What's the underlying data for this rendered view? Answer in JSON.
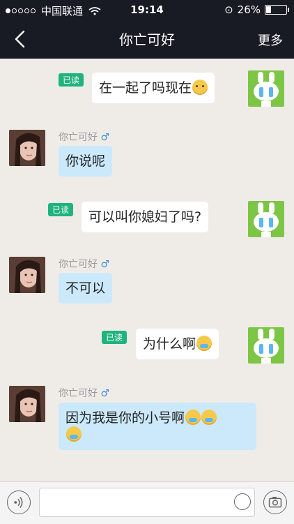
{
  "status": {
    "carrier": "中国联通",
    "time": "19:14",
    "battery": "26%",
    "battery_level": 0.26
  },
  "nav": {
    "title": "你亡可好",
    "more_label": "更多"
  },
  "contact": {
    "name": "你亡可好",
    "gender_icon": "♂"
  },
  "read_label": "已读",
  "messages": [
    {
      "from": "me",
      "text": "在一起了吗现在",
      "emoji": "shy"
    },
    {
      "from": "them",
      "text": "你说呢"
    },
    {
      "from": "me",
      "text": "可以叫你媳妇了吗?"
    },
    {
      "from": "them",
      "text": "不可以"
    },
    {
      "from": "me",
      "text": "为什么啊",
      "emoji": "cry"
    },
    {
      "from": "them",
      "text": "因为我是你的小号啊",
      "emoji": "cry"
    }
  ],
  "input": {
    "placeholder": ""
  },
  "colors": {
    "bar": "#181b24",
    "read": "#1fb37e",
    "their_bubble": "#cbe9fb",
    "bunny": "#7dc544"
  }
}
